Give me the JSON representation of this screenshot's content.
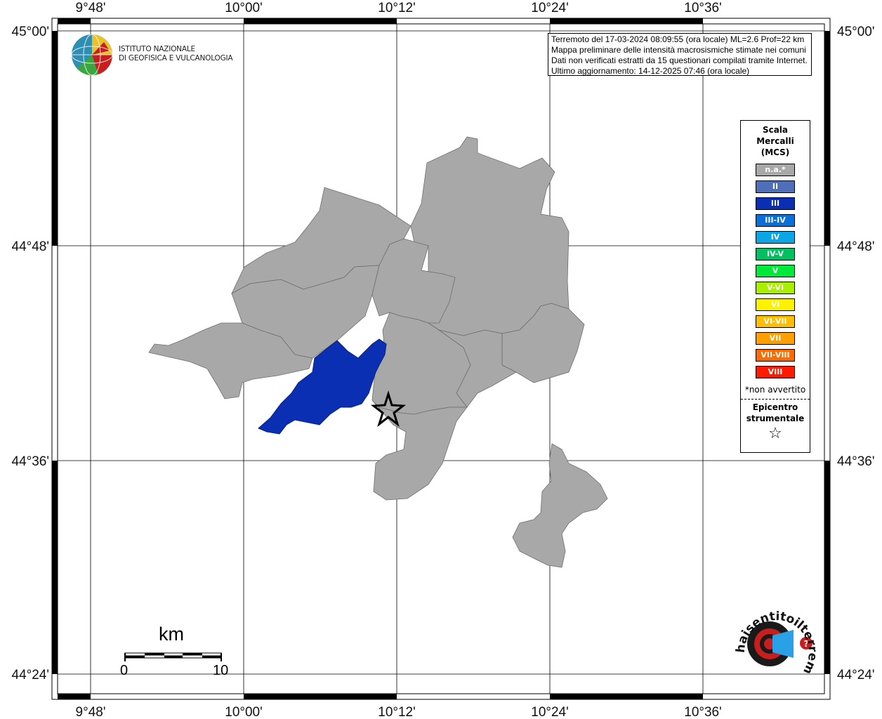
{
  "map": {
    "lon_labels": [
      "9°48'",
      "10°00'",
      "10°12'",
      "10°24'",
      "10°36'"
    ],
    "lat_labels": [
      "45°00'",
      "44°48'",
      "44°36'",
      "44°24'"
    ]
  },
  "info": {
    "line1": "Terremoto del 17-03-2024 08:09:55 (ora locale) ML=2.6 Prof=22 km",
    "line2": "Mappa preliminare delle intensità macrosismiche stimate nei comuni",
    "line3": "Dati non verificati estratti da 15 questionari compilati tramite Internet.",
    "line4": "Ultimo aggiornamento: 14-12-2025 07:46 (ora locale)"
  },
  "logo": {
    "line1": "ISTITUTO NAZIONALE",
    "line2": "DI GEOFISICA E VULCANOLOGIA"
  },
  "legend": {
    "title_line1": "Scala",
    "title_line2": "Mercalli",
    "title_line3": "(MCS)",
    "items": [
      {
        "label": "n.a.*",
        "color": "#a8a8a8"
      },
      {
        "label": "II",
        "color": "#4f6fb8"
      },
      {
        "label": "III",
        "color": "#0a2fb3"
      },
      {
        "label": "III-IV",
        "color": "#0a6fd6"
      },
      {
        "label": "IV",
        "color": "#0aa6e6"
      },
      {
        "label": "IV-V",
        "color": "#00c060"
      },
      {
        "label": "V",
        "color": "#00e83a"
      },
      {
        "label": "V-VI",
        "color": "#a8f000"
      },
      {
        "label": "VI",
        "color": "#fff200"
      },
      {
        "label": "VI-VII",
        "color": "#ffbf00"
      },
      {
        "label": "VII",
        "color": "#ff9f00"
      },
      {
        "label": "VII-VIII",
        "color": "#ff6a00"
      },
      {
        "label": "VIII",
        "color": "#ff1a00"
      }
    ],
    "note": "*non avvertito",
    "epicenter_line1": "Epicentro",
    "epicenter_line2": "strumentale",
    "epicenter_symbol": "☆"
  },
  "scale": {
    "unit": "km",
    "min_label": "0",
    "max_label": "10"
  },
  "colors": {
    "grey_area": "#a8a8a8",
    "blue_area": "#0a2fb3"
  },
  "watermark": {
    "text": "haisentitoilterremoto.it www",
    "icon": "megaphone-icon"
  }
}
